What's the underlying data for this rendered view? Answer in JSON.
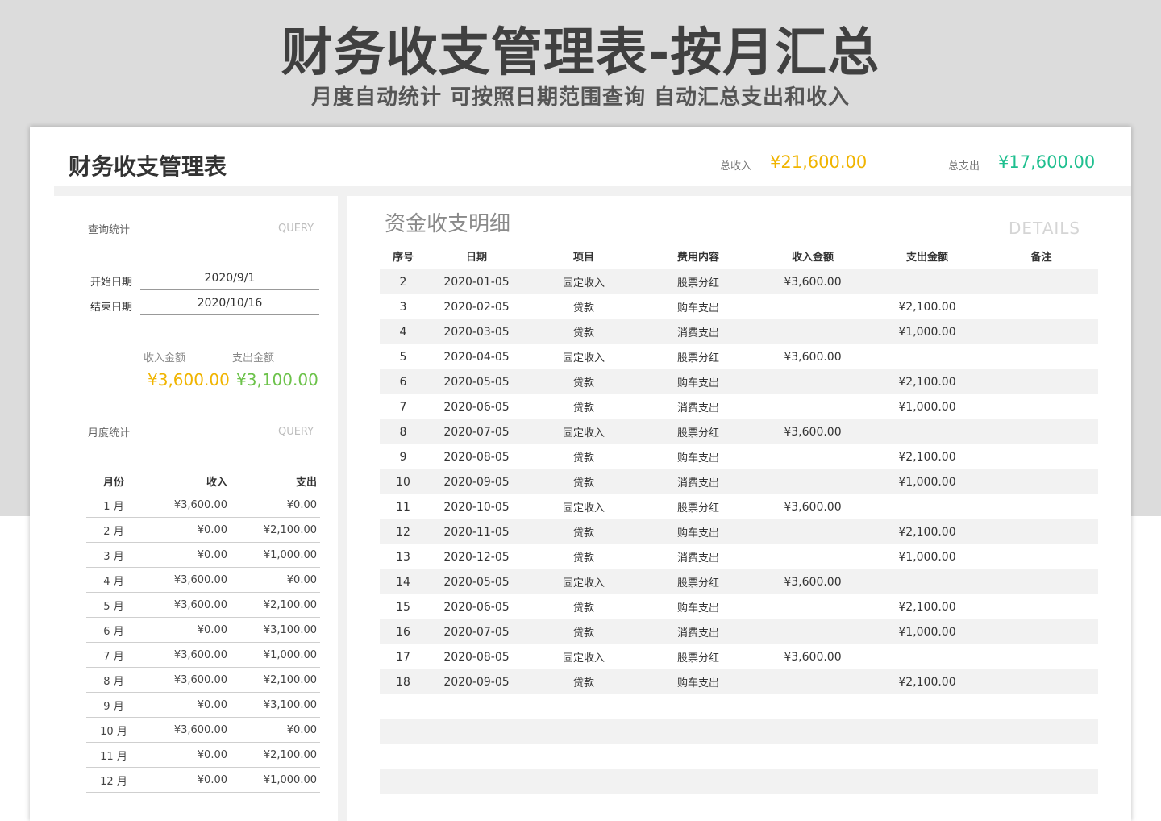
{
  "banner": {
    "title": "财务收支管理表-按月汇总",
    "subtitle": "月度自动统计  可按照日期范围查询  自动汇总支出和收入"
  },
  "header": {
    "title": "财务收支管理表",
    "total_income_label": "总收入",
    "total_income_value": "¥21,600.00",
    "total_expense_label": "总支出",
    "total_expense_value": "¥17,600.00"
  },
  "colors": {
    "income": "#f0b400",
    "expense": "#1fbf8f",
    "query_expense": "#6cc24a"
  },
  "query": {
    "label": "查询统计",
    "en": "QUERY",
    "start_label": "开始日期",
    "start_value": "2020/9/1",
    "end_label": "结束日期",
    "end_value": "2020/10/16",
    "income_label": "收入金额",
    "income_value": "¥3,600.00",
    "expense_label": "支出金额",
    "expense_value": "¥3,100.00"
  },
  "monthly": {
    "label": "月度统计",
    "en": "QUERY",
    "headers": [
      "月份",
      "收入",
      "支出"
    ],
    "rows": [
      [
        "1 月",
        "¥3,600.00",
        "¥0.00"
      ],
      [
        "2 月",
        "¥0.00",
        "¥2,100.00"
      ],
      [
        "3 月",
        "¥0.00",
        "¥1,000.00"
      ],
      [
        "4 月",
        "¥3,600.00",
        "¥0.00"
      ],
      [
        "5 月",
        "¥3,600.00",
        "¥2,100.00"
      ],
      [
        "6 月",
        "¥0.00",
        "¥3,100.00"
      ],
      [
        "7 月",
        "¥3,600.00",
        "¥1,000.00"
      ],
      [
        "8 月",
        "¥3,600.00",
        "¥2,100.00"
      ],
      [
        "9 月",
        "¥0.00",
        "¥3,100.00"
      ],
      [
        "10 月",
        "¥3,600.00",
        "¥0.00"
      ],
      [
        "11 月",
        "¥0.00",
        "¥2,100.00"
      ],
      [
        "12 月",
        "¥0.00",
        "¥1,000.00"
      ]
    ]
  },
  "details": {
    "title": "资金收支明细",
    "en": "DETAILS",
    "headers": [
      "序号",
      "日期",
      "项目",
      "费用内容",
      "收入金额",
      "支出金额",
      "备注"
    ],
    "rows": [
      [
        "2",
        "2020-01-05",
        "固定收入",
        "股票分红",
        "¥3,600.00",
        "",
        ""
      ],
      [
        "3",
        "2020-02-05",
        "贷款",
        "购车支出",
        "",
        "¥2,100.00",
        ""
      ],
      [
        "4",
        "2020-03-05",
        "贷款",
        "消费支出",
        "",
        "¥1,000.00",
        ""
      ],
      [
        "5",
        "2020-04-05",
        "固定收入",
        "股票分红",
        "¥3,600.00",
        "",
        ""
      ],
      [
        "6",
        "2020-05-05",
        "贷款",
        "购车支出",
        "",
        "¥2,100.00",
        ""
      ],
      [
        "7",
        "2020-06-05",
        "贷款",
        "消费支出",
        "",
        "¥1,000.00",
        ""
      ],
      [
        "8",
        "2020-07-05",
        "固定收入",
        "股票分红",
        "¥3,600.00",
        "",
        ""
      ],
      [
        "9",
        "2020-08-05",
        "贷款",
        "购车支出",
        "",
        "¥2,100.00",
        ""
      ],
      [
        "10",
        "2020-09-05",
        "贷款",
        "消费支出",
        "",
        "¥1,000.00",
        ""
      ],
      [
        "11",
        "2020-10-05",
        "固定收入",
        "股票分红",
        "¥3,600.00",
        "",
        ""
      ],
      [
        "12",
        "2020-11-05",
        "贷款",
        "购车支出",
        "",
        "¥2,100.00",
        ""
      ],
      [
        "13",
        "2020-12-05",
        "贷款",
        "消费支出",
        "",
        "¥1,000.00",
        ""
      ],
      [
        "14",
        "2020-05-05",
        "固定收入",
        "股票分红",
        "¥3,600.00",
        "",
        ""
      ],
      [
        "15",
        "2020-06-05",
        "贷款",
        "购车支出",
        "",
        "¥2,100.00",
        ""
      ],
      [
        "16",
        "2020-07-05",
        "贷款",
        "消费支出",
        "",
        "¥1,000.00",
        ""
      ],
      [
        "17",
        "2020-08-05",
        "固定收入",
        "股票分红",
        "¥3,600.00",
        "",
        ""
      ],
      [
        "18",
        "2020-09-05",
        "贷款",
        "购车支出",
        "",
        "¥2,100.00",
        ""
      ],
      [
        "",
        "",
        "",
        "",
        "",
        "",
        ""
      ],
      [
        "",
        "",
        "",
        "",
        "",
        "",
        ""
      ],
      [
        "",
        "",
        "",
        "",
        "",
        "",
        ""
      ],
      [
        "",
        "",
        "",
        "",
        "",
        "",
        ""
      ],
      [
        "",
        "",
        "",
        "",
        "",
        "",
        ""
      ]
    ]
  }
}
